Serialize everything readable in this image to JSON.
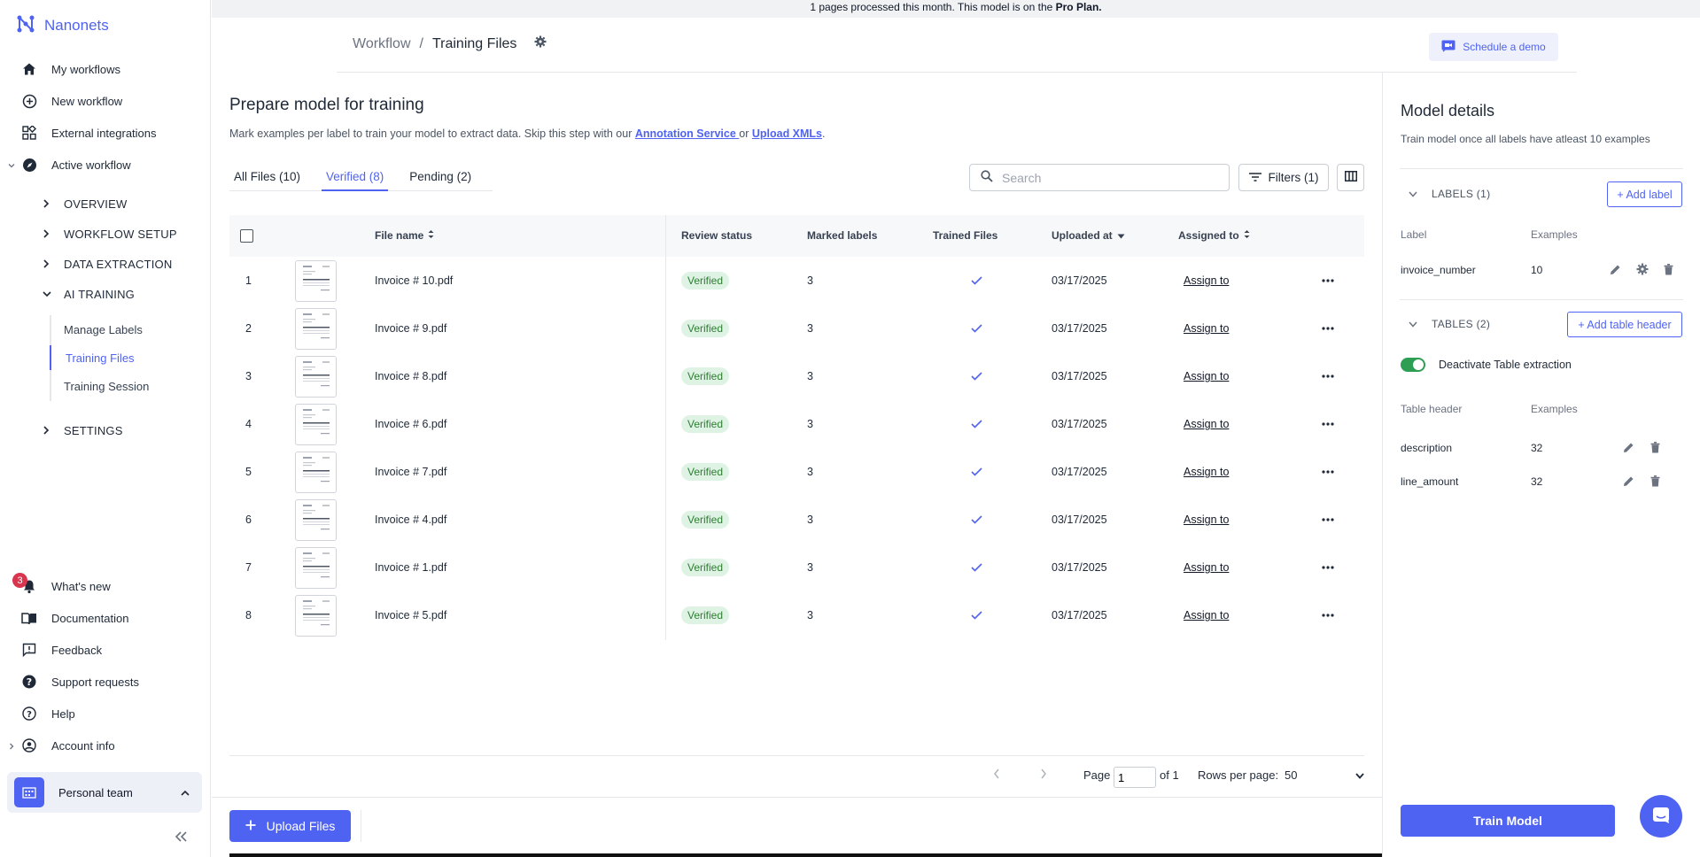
{
  "brand": {
    "name": "Nanonets"
  },
  "sidebar": {
    "items": [
      {
        "label": "My workflows",
        "icon": "home-icon"
      },
      {
        "label": "New workflow",
        "icon": "plus-circle-icon"
      },
      {
        "label": "External integrations",
        "icon": "integrations-icon"
      },
      {
        "label": "Active workflow",
        "icon": "compass-icon"
      }
    ],
    "sections": [
      "OVERVIEW",
      "WORKFLOW SETUP",
      "DATA EXTRACTION",
      "AI TRAINING",
      "SETTINGS"
    ],
    "ai_training_items": [
      "Manage Labels",
      "Training Files",
      "Training Session"
    ],
    "bottom_items": [
      {
        "label": "What's new",
        "icon": "bell-icon"
      },
      {
        "label": "Documentation",
        "icon": "book-icon"
      },
      {
        "label": "Feedback",
        "icon": "feedback-icon"
      },
      {
        "label": "Support requests",
        "icon": "help-circle-icon"
      },
      {
        "label": "Help",
        "icon": "question-icon"
      },
      {
        "label": "Account info",
        "icon": "account-icon"
      }
    ],
    "notification_count": "3",
    "team": "Personal team"
  },
  "banner": {
    "text": "1 pages processed this month. This model is on the ",
    "plan": "Pro Plan."
  },
  "header": {
    "breadcrumb_parent": "Workflow",
    "breadcrumb_sep": "/",
    "breadcrumb_current": "Training Files",
    "demo_button": "Schedule a demo"
  },
  "main": {
    "title": "Prepare model for training",
    "subtitle_text": "Mark examples per label to train your model to extract data. Skip this step with our ",
    "subtitle_link1": "Annotation Service ",
    "subtitle_or": "or ",
    "subtitle_link2": "Upload XMLs",
    "subtitle_end": ".",
    "tabs": [
      "All Files (10)",
      "Verified (8)",
      "Pending (2)"
    ],
    "search_placeholder": "Search",
    "filters_label": "Filters (1)"
  },
  "table": {
    "headers": {
      "file_name": "File name",
      "review_status": "Review status",
      "marked_labels": "Marked labels",
      "trained_files": "Trained Files",
      "uploaded_at": "Uploaded at",
      "assigned_to": "Assigned to"
    },
    "rows": [
      {
        "index": "1",
        "file": "Invoice # 10.pdf",
        "status": "Verified",
        "labels": "3",
        "date": "03/17/2025",
        "assign": "Assign to"
      },
      {
        "index": "2",
        "file": "Invoice # 9.pdf",
        "status": "Verified",
        "labels": "3",
        "date": "03/17/2025",
        "assign": "Assign to"
      },
      {
        "index": "3",
        "file": "Invoice # 8.pdf",
        "status": "Verified",
        "labels": "3",
        "date": "03/17/2025",
        "assign": "Assign to"
      },
      {
        "index": "4",
        "file": "Invoice # 6.pdf",
        "status": "Verified",
        "labels": "3",
        "date": "03/17/2025",
        "assign": "Assign to"
      },
      {
        "index": "5",
        "file": "Invoice # 7.pdf",
        "status": "Verified",
        "labels": "3",
        "date": "03/17/2025",
        "assign": "Assign to"
      },
      {
        "index": "6",
        "file": "Invoice # 4.pdf",
        "status": "Verified",
        "labels": "3",
        "date": "03/17/2025",
        "assign": "Assign to"
      },
      {
        "index": "7",
        "file": "Invoice # 1.pdf",
        "status": "Verified",
        "labels": "3",
        "date": "03/17/2025",
        "assign": "Assign to"
      },
      {
        "index": "8",
        "file": "Invoice # 5.pdf",
        "status": "Verified",
        "labels": "3",
        "date": "03/17/2025",
        "assign": "Assign to"
      }
    ]
  },
  "pagination": {
    "page_label": "Page",
    "page_value": "1",
    "of_label": "of 1",
    "rows_label": "Rows per page:",
    "rows_value": "50"
  },
  "upload_button": "Upload Files",
  "panel": {
    "title": "Model details",
    "subtitle": "Train model once all labels have atleast 10 examples",
    "labels_section": "LABELS (1)",
    "add_label": "+ Add label",
    "label_col": "Label",
    "examples_col": "Examples",
    "labels": [
      {
        "name": "invoice_number",
        "examples": "10"
      }
    ],
    "tables_section": "TABLES (2)",
    "add_table_header": "+ Add table header",
    "toggle_label": "Deactivate Table extraction",
    "table_header_col": "Table header",
    "table_examples_col": "Examples",
    "table_headers": [
      {
        "name": "description",
        "examples": "32"
      },
      {
        "name": "line_amount",
        "examples": "32"
      }
    ],
    "train_button": "Train Model"
  },
  "colors": {
    "accent": "#4f63f2",
    "verified_bg": "#dff3e4",
    "verified_text": "#2e7d32",
    "toggle_on": "#2e9e54"
  }
}
